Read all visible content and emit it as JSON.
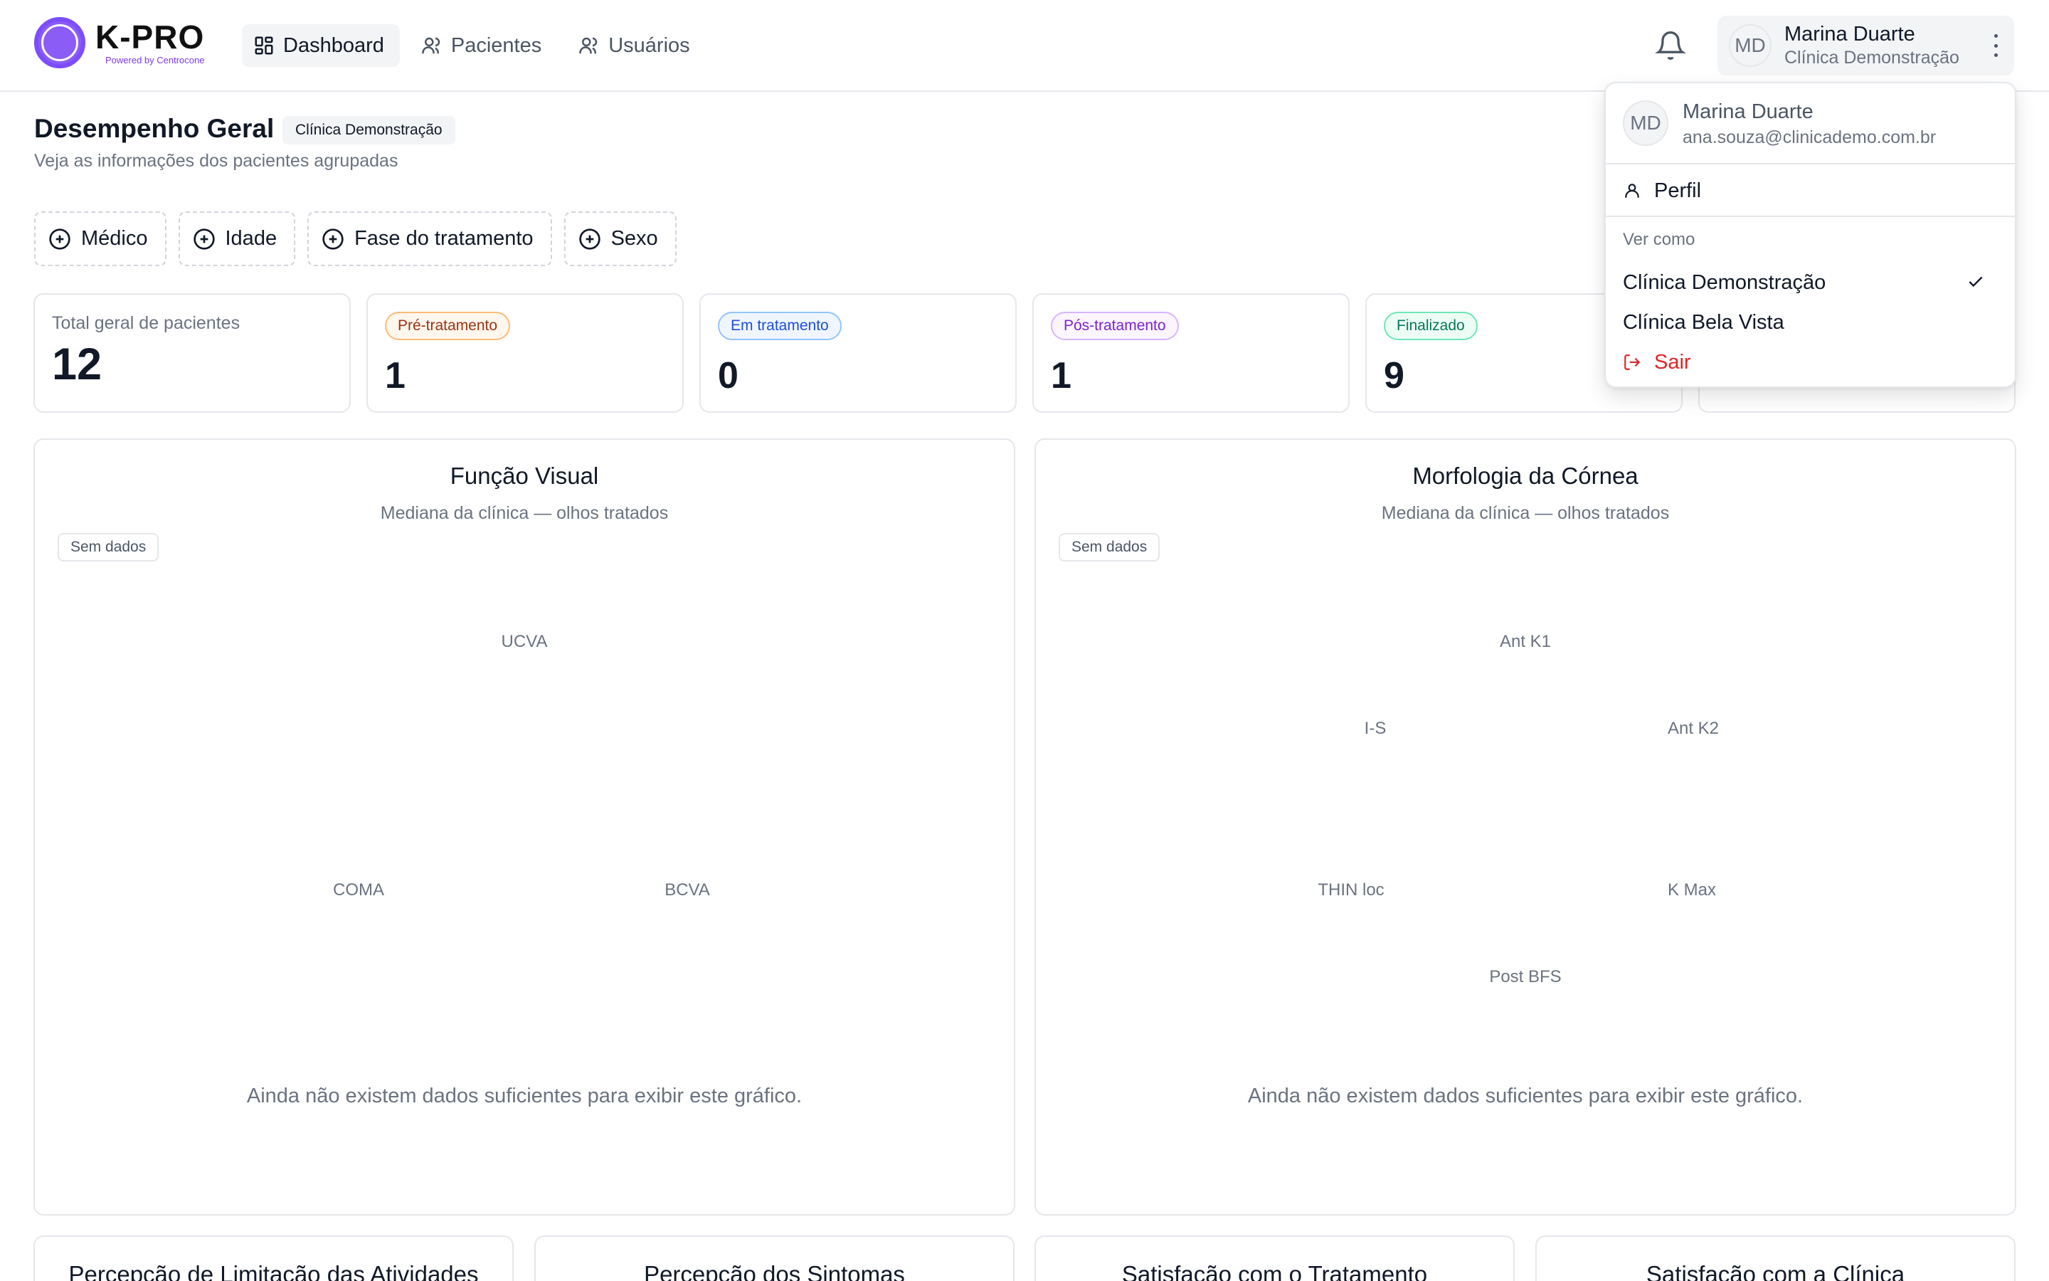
{
  "header": {
    "logo_title": "K-PRO",
    "logo_sub": "Powered by Centrocone",
    "nav": [
      {
        "label": "Dashboard",
        "icon": "dashboard-icon",
        "active": true
      },
      {
        "label": "Pacientes",
        "icon": "users-icon",
        "active": false
      },
      {
        "label": "Usuários",
        "icon": "users-icon",
        "active": false
      }
    ],
    "user": {
      "initials": "MD",
      "name": "Marina Duarte",
      "clinic": "Clínica Demonstração"
    }
  },
  "page": {
    "title": "Desempenho Geral",
    "badge": "Clínica Demonstração",
    "subtitle": "Veja as informações dos pacientes agrupadas"
  },
  "filters": [
    "Médico",
    "Idade",
    "Fase do tratamento",
    "Sexo"
  ],
  "stats": {
    "total": {
      "label": "Total geral de pacientes",
      "value": "12"
    },
    "pre": {
      "label": "Pré-tratamento",
      "value": "1"
    },
    "em": {
      "label": "Em tratamento",
      "value": "0"
    },
    "pos": {
      "label": "Pós-tratamento",
      "value": "1"
    },
    "fin": {
      "label": "Finalizado",
      "value": "9"
    }
  },
  "charts": {
    "visual": {
      "title": "Função Visual",
      "subtitle": "Mediana da clínica — olhos tratados",
      "badge": "Sem dados",
      "axes": [
        "UCVA",
        "BCVA",
        "COMA"
      ],
      "empty": "Ainda não existem dados suficientes para exibir este gráfico."
    },
    "cornea": {
      "title": "Morfologia da Córnea",
      "subtitle": "Mediana da clínica — olhos tratados",
      "badge": "Sem dados",
      "axes": [
        "Ant K1",
        "Ant K2",
        "K Max",
        "Post BFS",
        "THIN loc",
        "I-S"
      ],
      "empty": "Ainda não existem dados suficientes para exibir este gráfico."
    }
  },
  "bottom_cards": [
    "Percepção de Limitação das Atividades",
    "Percepção dos Sintomas",
    "Satisfação com o Tratamento",
    "Satisfação com a Clínica"
  ],
  "menu": {
    "initials": "MD",
    "name": "Marina Duarte",
    "email": "ana.souza@clinicademo.com.br",
    "profile": "Perfil",
    "view_as": "Ver como",
    "clinics": [
      {
        "name": "Clínica Demonstração",
        "selected": true
      },
      {
        "name": "Clínica Bela Vista",
        "selected": false
      }
    ],
    "logout": "Sair"
  },
  "colors": {
    "accent": "#8b5cf6",
    "danger": "#dc2626"
  }
}
